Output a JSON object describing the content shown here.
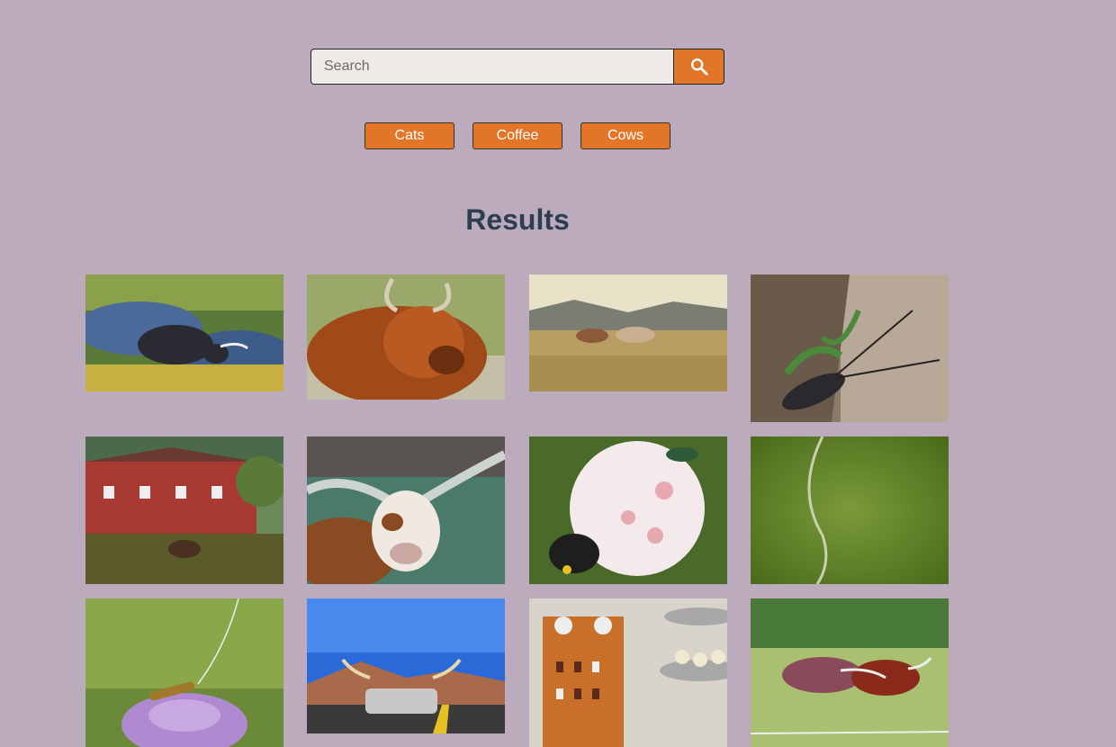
{
  "search": {
    "placeholder": "Search",
    "value": ""
  },
  "search_button": {
    "icon": "search-icon"
  },
  "categories": [
    "Cats",
    "Coffee",
    "Cows"
  ],
  "results": {
    "title": "Results"
  },
  "colors": {
    "background": "#bcaabd",
    "accent": "#e27527",
    "title": "#2c3e50"
  },
  "images": [
    {
      "name": "black-cow-grazing-on-rocks"
    },
    {
      "name": "highland-cow-portrait"
    },
    {
      "name": "two-cows-in-field"
    },
    {
      "name": "longhorn-beetle-on-plant"
    },
    {
      "name": "red-barn-with-cow"
    },
    {
      "name": "texas-longhorn-closeup"
    },
    {
      "name": "beetle-on-white-flower"
    },
    {
      "name": "green-blurred-stem"
    },
    {
      "name": "beetle-on-purple-flower"
    },
    {
      "name": "car-with-longhorns"
    },
    {
      "name": "clock-tower-cake"
    },
    {
      "name": "longhorn-cattle-grazing"
    }
  ]
}
